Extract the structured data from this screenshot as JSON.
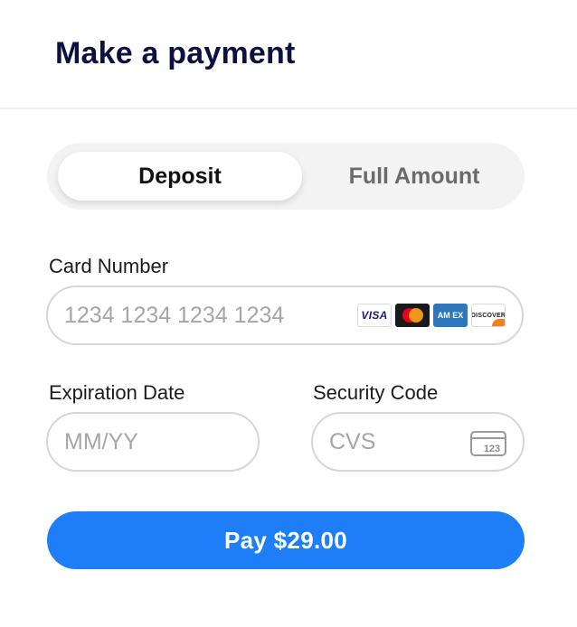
{
  "header": {
    "title": "Make a payment"
  },
  "payment_type": {
    "options": [
      {
        "label": "Deposit",
        "selected": true
      },
      {
        "label": "Full Amount",
        "selected": false
      }
    ]
  },
  "card_number": {
    "label": "Card Number",
    "placeholder": "1234 1234 1234 1234",
    "value": "",
    "brands": [
      {
        "icon": "visa-logo",
        "text": "VISA"
      },
      {
        "icon": "mastercard-logo",
        "text": ""
      },
      {
        "icon": "amex-logo",
        "text": "AM EX"
      },
      {
        "icon": "discover-logo",
        "text": "DISCOVER"
      }
    ]
  },
  "expiration": {
    "label": "Expiration Date",
    "placeholder": "MM/YY",
    "value": ""
  },
  "security_code": {
    "label": "Security Code",
    "placeholder": "CVS",
    "value": "",
    "icon": "card-cvc-icon",
    "icon_text": "123"
  },
  "submit": {
    "label": "Pay $29.00"
  },
  "colors": {
    "accent": "#1e7ef7",
    "title": "#0d1140",
    "border": "#d7d7d7",
    "toggle_bg": "#f3f3f3"
  }
}
